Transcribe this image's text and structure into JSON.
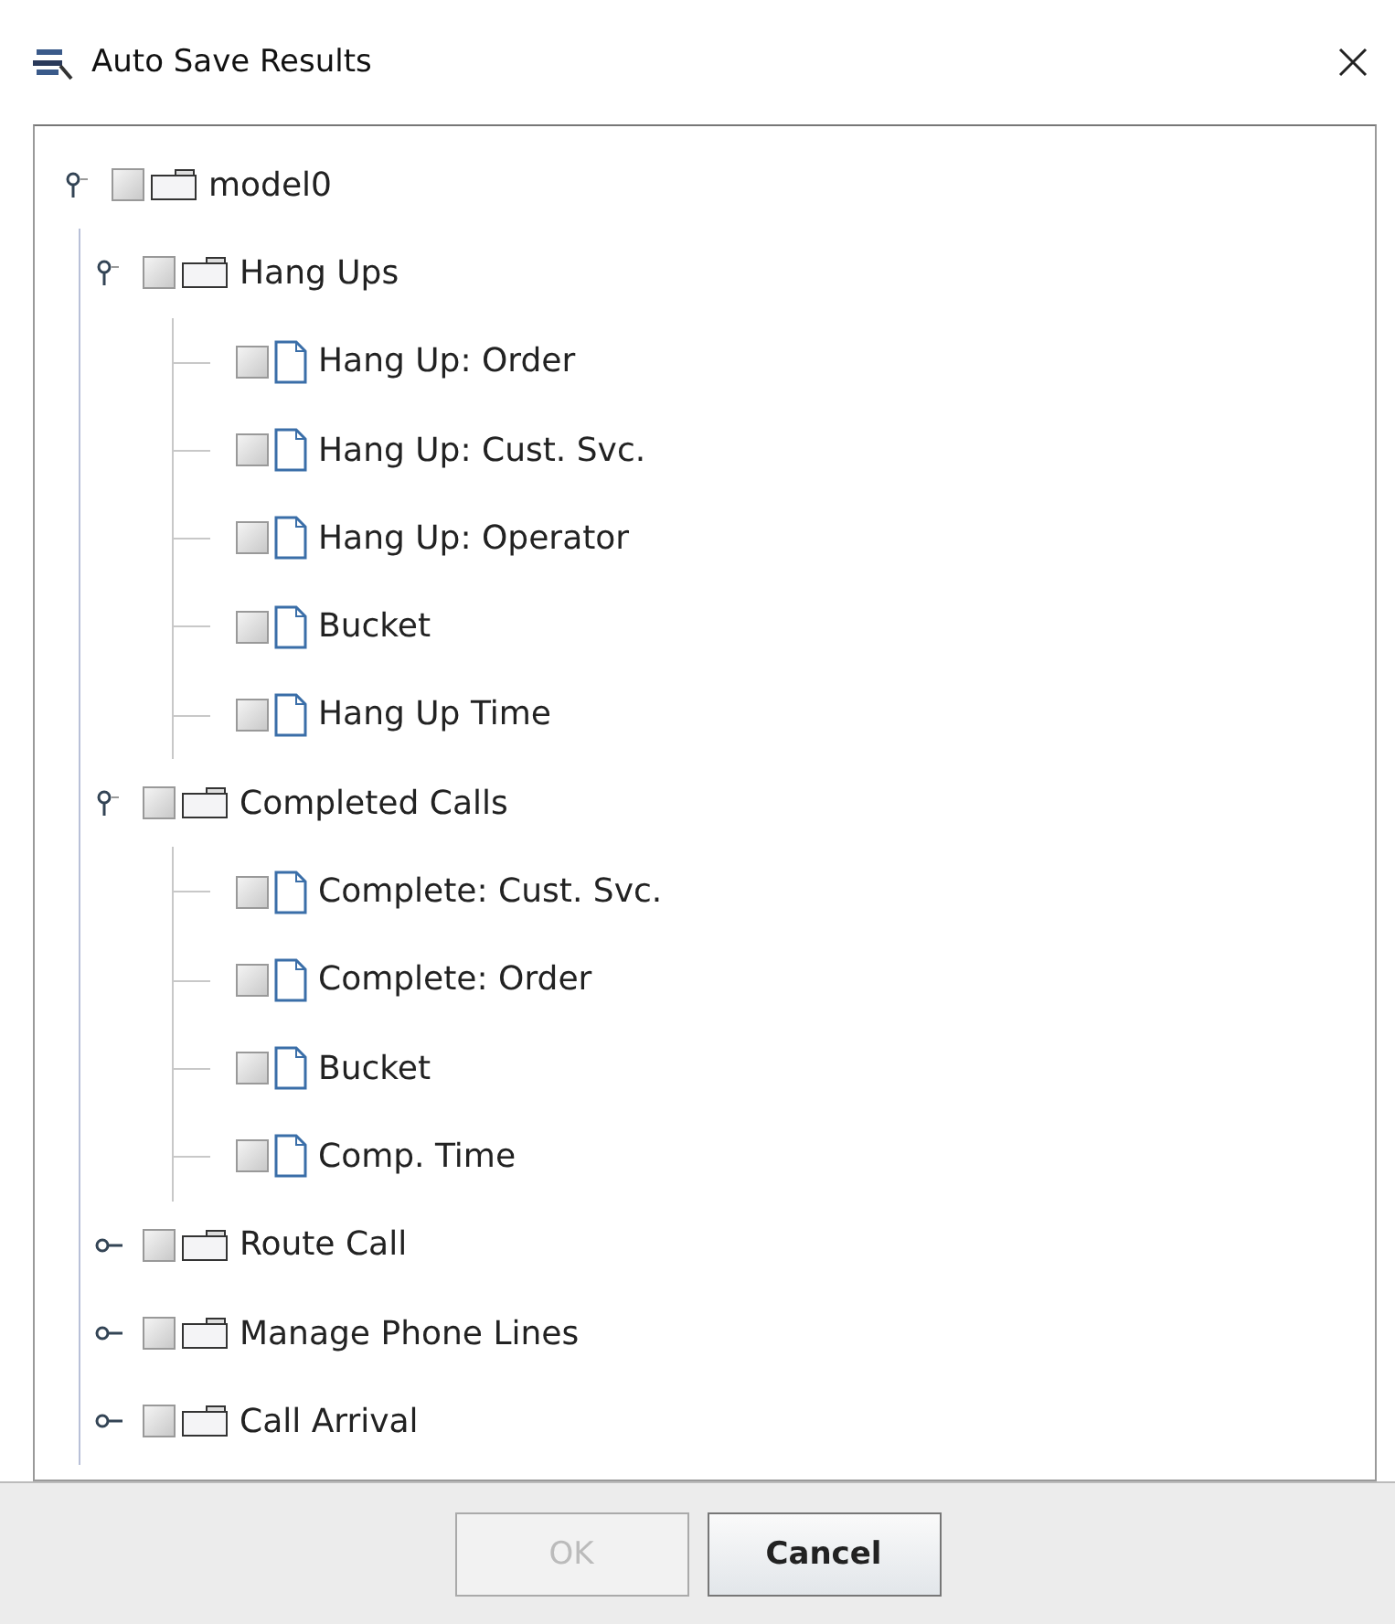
{
  "window": {
    "title": "Auto Save Results"
  },
  "tree": [
    {
      "label": "model0",
      "kind": "folder",
      "checked": false,
      "expanded": true,
      "children": [
        {
          "label": "Hang Ups",
          "kind": "folder",
          "checked": false,
          "expanded": true,
          "children": [
            {
              "label": "Hang Up: Order",
              "kind": "file",
              "checked": false
            },
            {
              "label": "Hang Up: Cust. Svc.",
              "kind": "file",
              "checked": false
            },
            {
              "label": "Hang Up: Operator",
              "kind": "file",
              "checked": false
            },
            {
              "label": "Bucket",
              "kind": "file",
              "checked": false
            },
            {
              "label": "Hang Up Time",
              "kind": "file",
              "checked": false
            }
          ]
        },
        {
          "label": "Completed Calls",
          "kind": "folder",
          "checked": false,
          "expanded": true,
          "children": [
            {
              "label": "Complete: Cust. Svc.",
              "kind": "file",
              "checked": false
            },
            {
              "label": "Complete: Order",
              "kind": "file",
              "checked": false
            },
            {
              "label": "Bucket",
              "kind": "file",
              "checked": false
            },
            {
              "label": "Comp. Time",
              "kind": "file",
              "checked": false
            }
          ]
        },
        {
          "label": "Route Call",
          "kind": "folder",
          "checked": false,
          "expanded": false
        },
        {
          "label": "Manage Phone Lines",
          "kind": "folder",
          "checked": false,
          "expanded": false
        },
        {
          "label": "Call Arrival",
          "kind": "folder",
          "checked": false,
          "expanded": false
        }
      ]
    }
  ],
  "buttons": [
    {
      "label": "OK",
      "disabled": true
    },
    {
      "label": "Cancel",
      "disabled": false
    }
  ]
}
